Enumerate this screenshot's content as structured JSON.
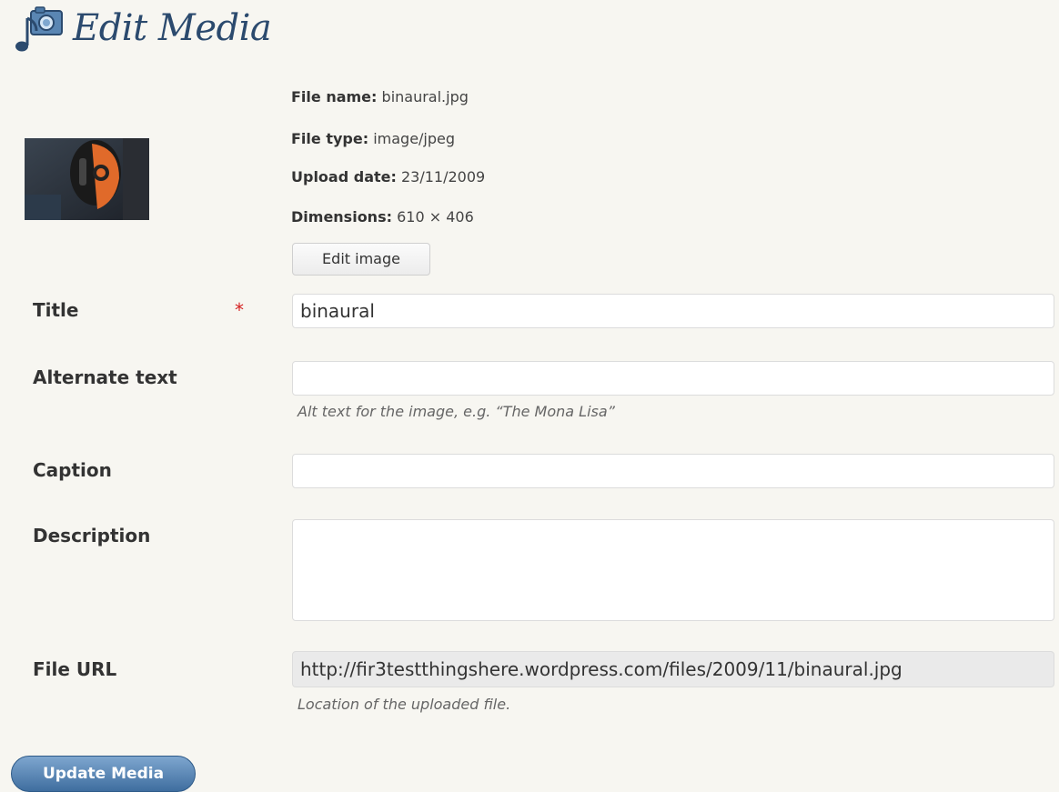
{
  "header": {
    "title": "Edit Media",
    "icon": "media-music-camera-icon"
  },
  "file_info": {
    "thumbnail_icon": "image-thumbnail",
    "file_name_label": "File name:",
    "file_name": "binaural.jpg",
    "file_type_label": "File type:",
    "file_type": "image/jpeg",
    "upload_date_label": "Upload date:",
    "upload_date": "23/11/2009",
    "dimensions_label": "Dimensions:",
    "dimensions": "610 × 406",
    "edit_image_label": "Edit image"
  },
  "form": {
    "title_label": "Title",
    "title_required": "*",
    "title_value": "binaural",
    "alt_label": "Alternate text",
    "alt_value": "",
    "alt_hint": "Alt text for the image, e.g. “The Mona Lisa”",
    "caption_label": "Caption",
    "caption_value": "",
    "description_label": "Description",
    "description_value": "",
    "file_url_label": "File URL",
    "file_url_value": "http://fir3testthingshere.wordpress.com/files/2009/11/binaural.jpg",
    "file_url_hint": "Location of the uploaded file."
  },
  "actions": {
    "update_label": "Update Media"
  },
  "colors": {
    "background": "#f7f6f1",
    "title_blue": "#2b4a6e",
    "required_red": "#d42020",
    "button_blue": "#3f6e9f"
  }
}
